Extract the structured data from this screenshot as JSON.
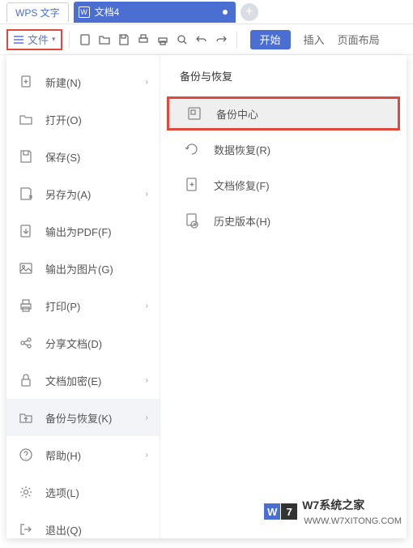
{
  "tabs": {
    "app_tab": "WPS 文字",
    "doc_tab": "文档4"
  },
  "toolbar": {
    "file_label": "文件",
    "start_label": "开始",
    "insert_label": "插入",
    "layout_label": "页面布局"
  },
  "menu": {
    "items": [
      {
        "label": "新建(N)",
        "icon": "new",
        "arrow": true
      },
      {
        "label": "打开(O)",
        "icon": "open",
        "arrow": false
      },
      {
        "label": "保存(S)",
        "icon": "save",
        "arrow": false
      },
      {
        "label": "另存为(A)",
        "icon": "saveas",
        "arrow": true
      },
      {
        "label": "输出为PDF(F)",
        "icon": "pdf",
        "arrow": false
      },
      {
        "label": "输出为图片(G)",
        "icon": "image",
        "arrow": false
      },
      {
        "label": "打印(P)",
        "icon": "print",
        "arrow": true
      },
      {
        "label": "分享文档(D)",
        "icon": "share",
        "arrow": false
      },
      {
        "label": "文档加密(E)",
        "icon": "encrypt",
        "arrow": true
      },
      {
        "label": "备份与恢复(K)",
        "icon": "backup",
        "arrow": true,
        "selected": true
      },
      {
        "label": "帮助(H)",
        "icon": "help",
        "arrow": true
      },
      {
        "label": "选项(L)",
        "icon": "options",
        "arrow": false
      },
      {
        "label": "退出(Q)",
        "icon": "exit",
        "arrow": false
      }
    ]
  },
  "submenu": {
    "title": "备份与恢复",
    "items": [
      {
        "label": "备份中心",
        "icon": "backup-center",
        "highlight": true
      },
      {
        "label": "数据恢复(R)",
        "icon": "data-recovery"
      },
      {
        "label": "文档修复(F)",
        "icon": "doc-repair"
      },
      {
        "label": "历史版本(H)",
        "icon": "history"
      }
    ]
  },
  "watermark": {
    "brand": "W7系统之家",
    "url": "WWW.W7XITONG.COM"
  }
}
